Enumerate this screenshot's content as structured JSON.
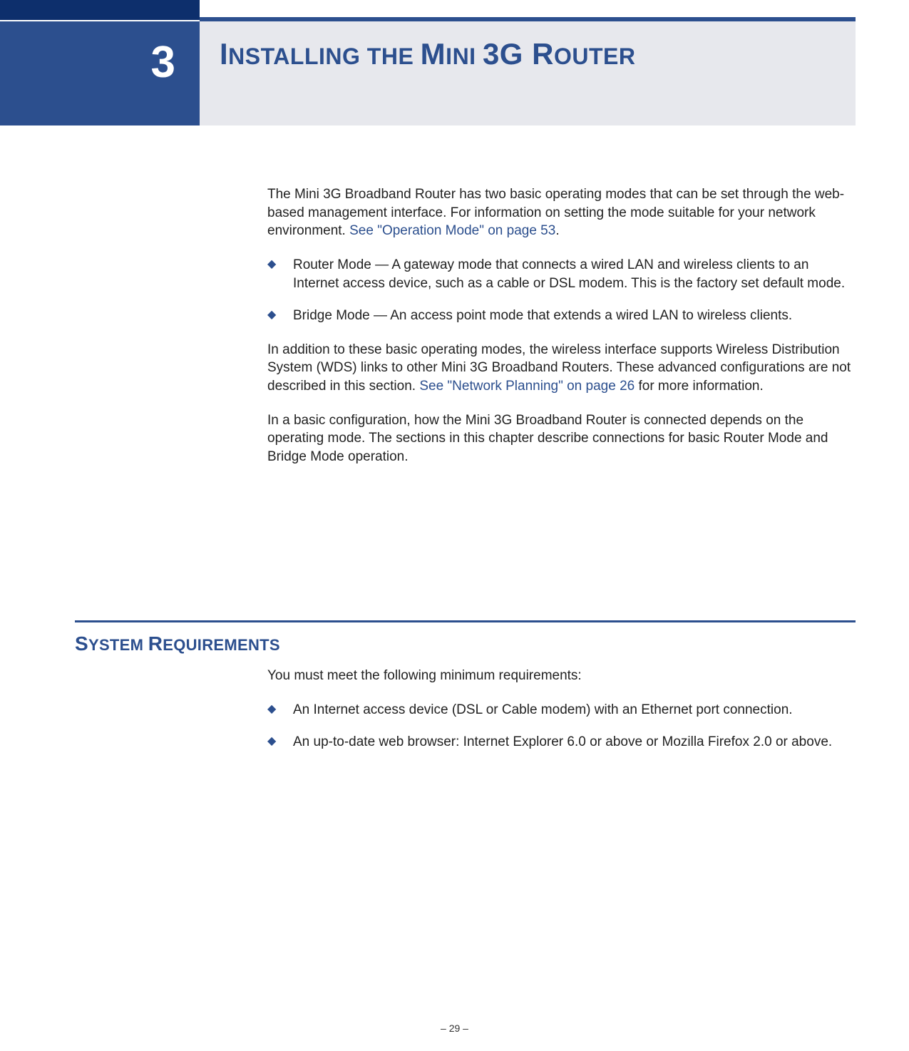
{
  "chapter": {
    "number": "3",
    "title_html": "INSTALLING THE MINI 3G ROUTER"
  },
  "intro": {
    "p1_pre": "The Mini 3G Broadband Router has two basic operating modes that can be set through the web-based management interface. For information on setting the mode suitable for your network environment. ",
    "p1_link": "See \"Operation Mode\" on page 53",
    "p1_post": ".",
    "bullets": [
      "Router Mode — A gateway mode that connects a wired LAN and wireless clients to an Internet access device, such as a cable or DSL modem. This is the factory set default mode.",
      "Bridge Mode — An access point mode that extends a wired LAN to wireless clients."
    ],
    "p2_pre": "In addition to these basic operating modes, the wireless interface supports Wireless Distribution System (WDS) links to other Mini 3G Broadband Routers. These advanced configurations are not described in this section. ",
    "p2_link": "See \"Network Planning\" on page 26",
    "p2_post": " for more information.",
    "p3": "In a basic configuration, how the Mini 3G Broadband Router is connected depends on the operating mode. The sections in this chapter describe connections for basic Router Mode and Bridge Mode operation."
  },
  "section": {
    "heading": "SYSTEM REQUIREMENTS",
    "p1": "You must meet the following minimum requirements:",
    "bullets": [
      "An Internet access device (DSL or Cable modem) with an Ethernet port connection.",
      "An up-to-date web browser: Internet Explorer 6.0 or above or Mozilla Firefox 2.0 or above."
    ]
  },
  "footer": {
    "page": "– 29 –"
  }
}
